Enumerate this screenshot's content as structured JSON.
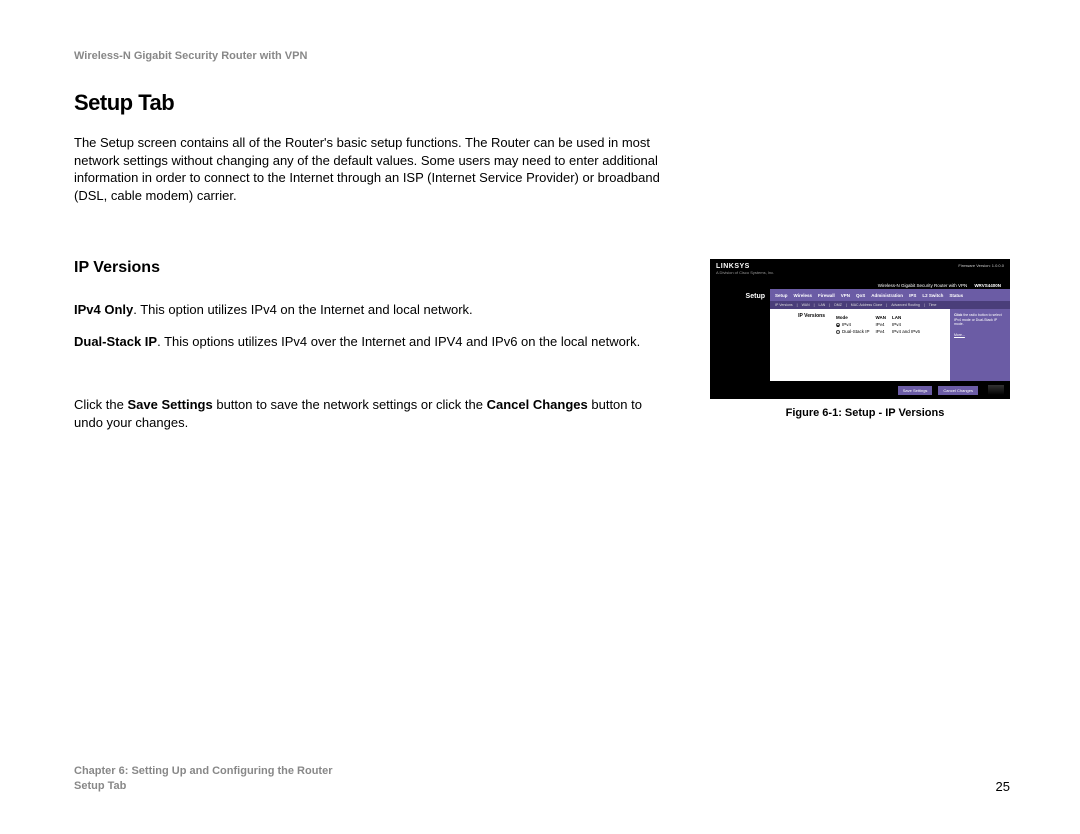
{
  "header": {
    "doc_title": "Wireless-N Gigabit Security Router with VPN"
  },
  "main": {
    "title": "Setup Tab",
    "intro": "The Setup screen contains all of the Router's basic setup functions. The Router can be used in most network settings without changing any of the default values. Some users may need to enter additional information in order to connect to the Internet through an ISP (Internet Service Provider) or broadband (DSL, cable modem) carrier.",
    "section_heading": "IP Versions",
    "p1_bold": "IPv4 Only",
    "p1_rest": ". This option utilizes IPv4 on the Internet and local network.",
    "p2_bold": "Dual-Stack IP",
    "p2_rest": ". This options utilizes IPv4 over the Internet and IPV4 and IPv6 on the local network.",
    "p3_pre": "Click the ",
    "p3_bold1": "Save Settings",
    "p3_mid": " button to save the network settings or click the ",
    "p3_bold2": "Cancel Changes",
    "p3_post": " button to undo your changes."
  },
  "figure": {
    "caption": "Figure 6-1: Setup - IP Versions",
    "brand": "LINKSYS",
    "brand_sub": "A Division of Cisco Systems, Inc.",
    "fw": "Firmware Version: 1.0.0.0",
    "product": "Wireless-N Gigabit Security Router with VPN",
    "model": "WRVS4400N",
    "active_tab": "Setup",
    "tabs": [
      "Setup",
      "Wireless",
      "Firewall",
      "VPN",
      "QoS",
      "Administration",
      "IPS",
      "L2 Switch",
      "Status"
    ],
    "subtabs": [
      "IP Versions",
      "WAN",
      "LAN",
      "DMZ",
      "MAC Address Clone",
      "Advanced Routing",
      "Time"
    ],
    "panel_label": "IP Versions",
    "table": {
      "headers": [
        "Mode",
        "WAN",
        "LAN"
      ],
      "rows": [
        {
          "mode": "IPv4",
          "wan": "IPv4",
          "lan": "IPv4",
          "selected": true
        },
        {
          "mode": "Dual-Stack IP",
          "wan": "IPv4",
          "lan": "IPv4 and IPv6",
          "selected": false
        }
      ]
    },
    "help_title": "Click",
    "help_text": " the radio button to select IPv4 mode or Dual-Stack IP mode.",
    "help_more": "More...",
    "btn_save": "Save Settings",
    "btn_cancel": "Cancel Changes"
  },
  "footer": {
    "chapter": "Chapter 6: Setting Up and Configuring the Router",
    "section": "Setup Tab",
    "page": "25"
  }
}
